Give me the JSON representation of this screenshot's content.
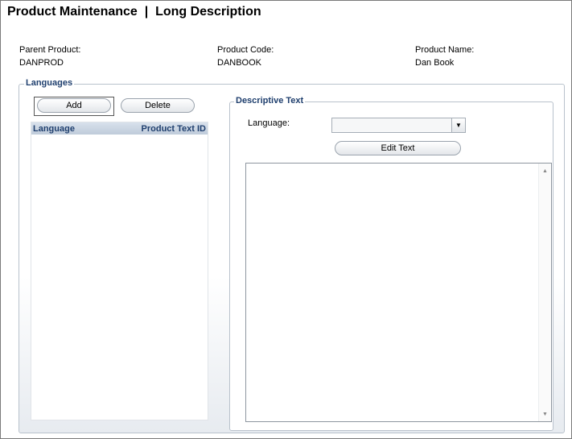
{
  "page": {
    "title": "Product Maintenance  |  Long Description"
  },
  "product": {
    "parent_label": "Parent Product:",
    "parent_value": "DANPROD",
    "code_label": "Product Code:",
    "code_value": "DANBOOK",
    "name_label": "Product Name:",
    "name_value": "Dan Book"
  },
  "languages": {
    "legend": "Languages",
    "add_label": "Add",
    "delete_label": "Delete",
    "columns": [
      "Language",
      "Product Text ID"
    ],
    "rows": []
  },
  "descriptive_text": {
    "legend": "Descriptive Text",
    "language_label": "Language:",
    "language_selected": "",
    "edit_label": "Edit Text",
    "text_value": ""
  },
  "icons": {
    "dropdown": "chevron-down-icon",
    "scroll_up": "arrow-up-icon",
    "scroll_down": "arrow-down-icon"
  },
  "colors": {
    "legend": "#1f3f6e",
    "header_start": "#d8e1ec",
    "header_end": "#bfcbda",
    "border": "#b9c2cc"
  }
}
